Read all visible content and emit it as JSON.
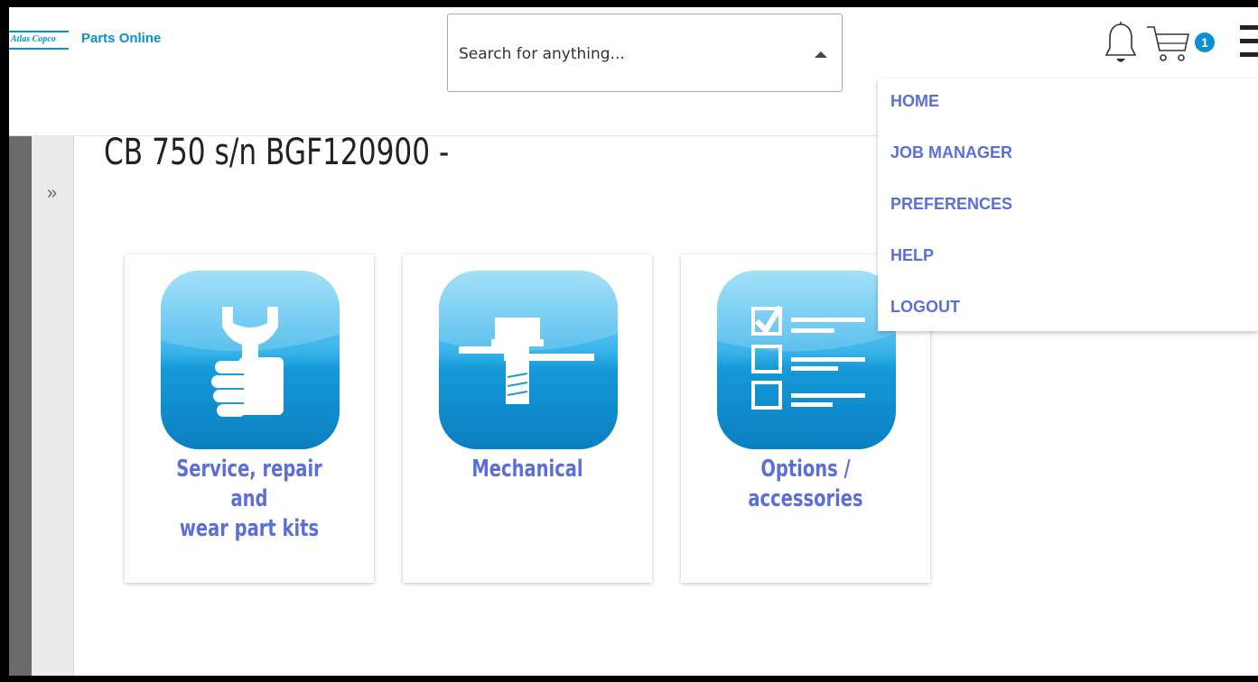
{
  "header": {
    "logo_text": "Atlas Copco",
    "app_title": "Parts Online",
    "search_placeholder": "Search for anything...",
    "cart_count": "1",
    "icons": [
      "bell-icon",
      "cart-icon",
      "hamburger-icon",
      "caret-up-icon"
    ]
  },
  "sidebar": {
    "expand_glyph": "»"
  },
  "page": {
    "title": "CB 750 s/n BGF120900 -"
  },
  "tiles": [
    {
      "label_line1": "Service, repair and",
      "label_line2": "wear part kits",
      "icon": "wrench-fist-icon"
    },
    {
      "label_line1": "Mechanical",
      "label_line2": "",
      "icon": "bolt-icon"
    },
    {
      "label_line1": "Options / accessories",
      "label_line2": "",
      "icon": "checklist-icon"
    }
  ],
  "menu": {
    "items": [
      {
        "label": "HOME"
      },
      {
        "label": "JOB MANAGER"
      },
      {
        "label": "PREFERENCES"
      },
      {
        "label": "HELP"
      },
      {
        "label": "LOGOUT"
      }
    ]
  },
  "colors": {
    "brand": "#0a8fd0",
    "link": "#5b6fd6",
    "tile_icon_top": "#7fd3f5",
    "tile_icon_bottom": "#0a86c8"
  }
}
